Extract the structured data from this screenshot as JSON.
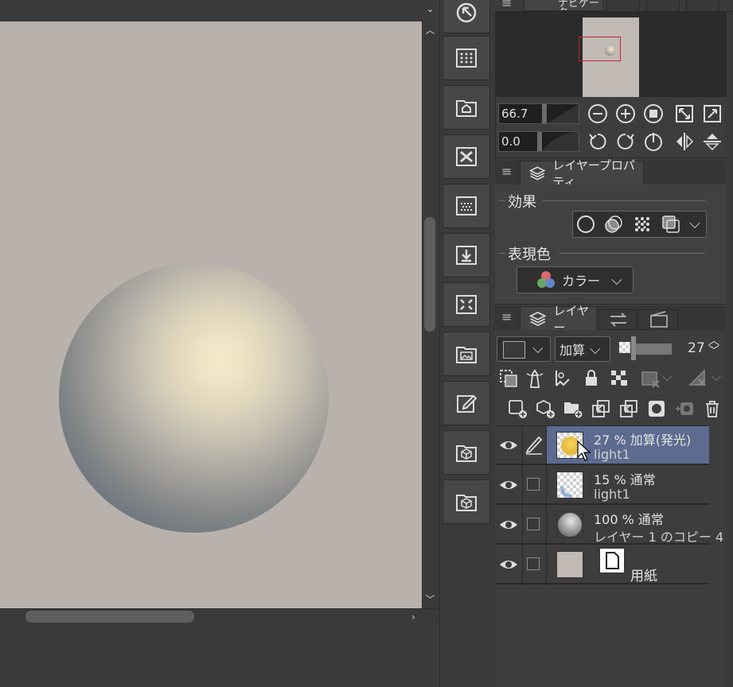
{
  "navigator": {
    "tab_label": "ナビゲーター",
    "zoom_value": "66.7",
    "rotate_value": "0.0"
  },
  "layer_property": {
    "tab_label": "レイヤープロパティ",
    "effect_label": "効果",
    "expression_color_label": "表現色",
    "expression_color_value": "カラー"
  },
  "layer_panel": {
    "tab_label": "レイヤー",
    "blend_mode": "加算",
    "opacity_value": "27",
    "layers": [
      {
        "line1": "27 % 加算(発光)",
        "line2": "light1",
        "selected": true
      },
      {
        "line1": "15 % 通常",
        "line2": "light1",
        "selected": false
      },
      {
        "line1": "100 % 通常",
        "line2": "レイヤー 1 のコピー 4",
        "selected": false
      },
      {
        "line1": "",
        "line2": "用紙",
        "selected": false
      }
    ]
  },
  "colors": {
    "paper": "#b9b1ac",
    "selected_row": "#5c6b8f",
    "sphere_highlight": "#f5ebc9",
    "sphere_shadow": "#5a6570"
  },
  "icons": [
    "zoom-out-icon",
    "zoom-in-icon",
    "fit-icon",
    "flip-horizontal-icon",
    "flip-vertical-icon",
    "rotate-left-icon",
    "rotate-right-icon",
    "reset-rotate-icon",
    "eye-icon",
    "pen-icon",
    "trash-icon"
  ]
}
